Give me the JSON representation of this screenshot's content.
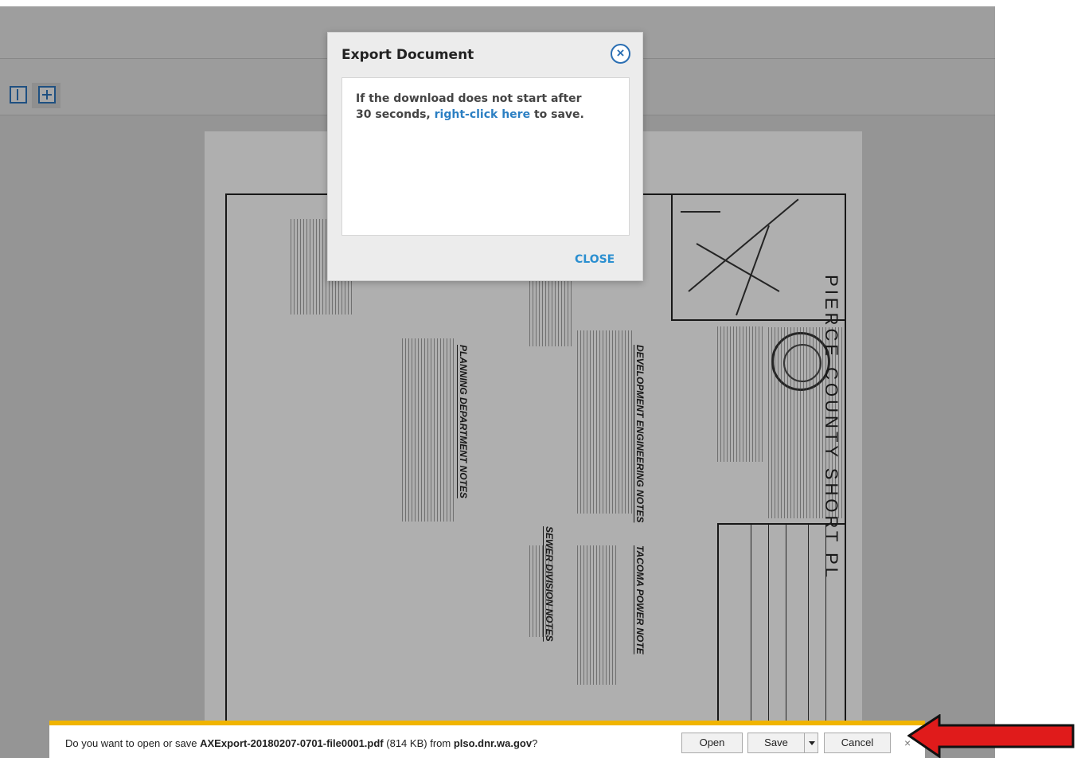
{
  "modal": {
    "title": "Export Document",
    "message_before": "If the download does not start after 30 seconds,",
    "link_text": "right-click here",
    "message_after": "to save.",
    "close_button": "CLOSE"
  },
  "document": {
    "county_title": "PIERCE COUNTY SHORT PL",
    "section_titles": [
      "DEVELOPMENT ENGINEERING NOTES",
      "PLANNING DEPARTMENT NOTES",
      "TACOMA POWER NOTE",
      "SEWER DIVISION NOTES"
    ]
  },
  "download_bar": {
    "prompt": "Do you want to open or save",
    "filename": "AXExport-20180207-0701-file0001.pdf",
    "size": "(814 KB)",
    "from": "from",
    "source": "plso.dnr.wa.gov",
    "suffix": "?",
    "open": "Open",
    "save": "Save",
    "cancel": "Cancel",
    "close_symbol": "×"
  },
  "colors": {
    "accent": "#2b7fc3",
    "download_bar_border": "#f0b400",
    "annotation_arrow": "#e01b1b"
  }
}
